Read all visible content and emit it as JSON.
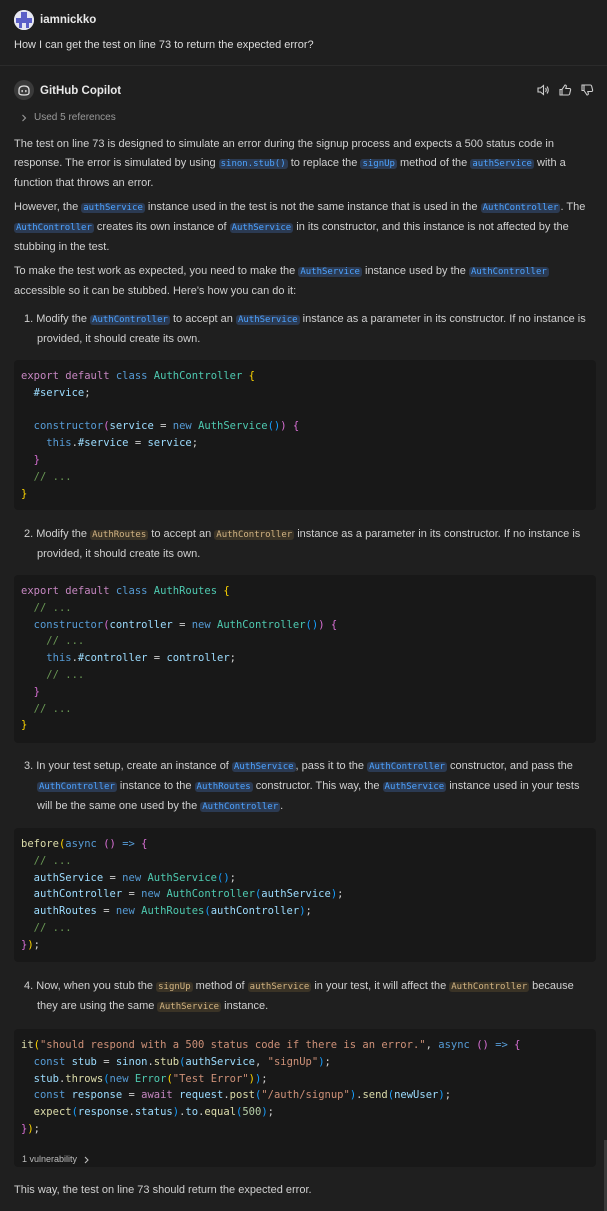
{
  "user": {
    "name": "iamnickko",
    "question": "How I can get the test on line 73 to return the expected error?"
  },
  "copilot": {
    "name": "GitHub Copilot",
    "references": "Used 5 references",
    "actions": [
      "speaker-icon",
      "thumbs-up-icon",
      "thumbs-down-icon"
    ]
  },
  "p1": {
    "t1": "The test on line 73 is designed to simulate an error during the signup process and expects a 500 status code in response. The error is simulated by using ",
    "c1": "sinon.stub()",
    "t2": " to replace the ",
    "c2": "signUp",
    "t3": " method of the ",
    "c3": "authService",
    "t4": " with a function that throws an error."
  },
  "p2": {
    "t1": "However, the ",
    "c1": "authService",
    "t2": " instance used in the test is not the same instance that is used in the ",
    "c2": "AuthController",
    "t3": ". The ",
    "c3": "AuthController",
    "t4": " creates its own instance of ",
    "c4": "AuthService",
    "t5": " in its constructor, and this instance is not affected by the stubbing in the test."
  },
  "p3": {
    "t1": "To make the test work as expected, you need to make the ",
    "c1": "AuthService",
    "t2": " instance used by the ",
    "c2": "AuthController",
    "t3": " accessible so it can be stubbed. Here's how you can do it:"
  },
  "step1": {
    "n": "1.",
    "t1": "Modify the ",
    "c1": "AuthController",
    "t2": " to accept an ",
    "c2": "AuthService",
    "t3": " instance as a parameter in its constructor. If no instance is provided, it should create its own."
  },
  "step2": {
    "n": "2.",
    "t1": "Modify the ",
    "c1": "AuthRoutes",
    "t2": " to accept an ",
    "c2": "AuthController",
    "t3": " instance as a parameter in its constructor. If no instance is provided, it should create its own."
  },
  "step3": {
    "n": "3.",
    "t1": "In your test setup, create an instance of ",
    "c1": "AuthService",
    "t2": ", pass it to the ",
    "c2": "AuthController",
    "t3": " constructor, and pass the ",
    "c3": "AuthController",
    "t4": " instance to the ",
    "c4": "AuthRoutes",
    "t5": " constructor. This way, the ",
    "c5": "AuthService",
    "t6": " instance used in your tests will be the same one used by the ",
    "c6": "AuthController",
    "t7": "."
  },
  "step4": {
    "n": "4.",
    "t1": "Now, when you stub the ",
    "c1": "signUp",
    "t2": " method of ",
    "c2": "authService",
    "t3": " in your test, it will affect the ",
    "c3": "AuthController",
    "t4": " because they are using the same ",
    "c4": "AuthService",
    "t5": " instance."
  },
  "code1": "export default class AuthController {\n  #service;\n\n  constructor(service = new AuthService()) {\n    this.#service = service;\n  }\n  // ...\n}",
  "code2": "export default class AuthRoutes {\n  // ...\n  constructor(controller = new AuthController()) {\n    // ...\n    this.#controller = controller;\n    // ...\n  }\n  // ...\n}",
  "code3": "before(async () => {\n  // ...\n  authService = new AuthService();\n  authController = new AuthController(authService);\n  authRoutes = new AuthRoutes(authController);\n  // ...\n});",
  "code4": "it(\"should respond with a 500 status code if there is an error.\", async () => {\n  const stub = sinon.stub(authService, \"signUp\");\n  stub.throws(new Error(\"Test Error\"));\n  const response = await request.post(\"/auth/signup\").send(newUser);\n  expect(response.status).to.equal(500);\n});",
  "vulnerability": "1 vulnerability",
  "final": "This way, the test on line 73 should return the expected error."
}
